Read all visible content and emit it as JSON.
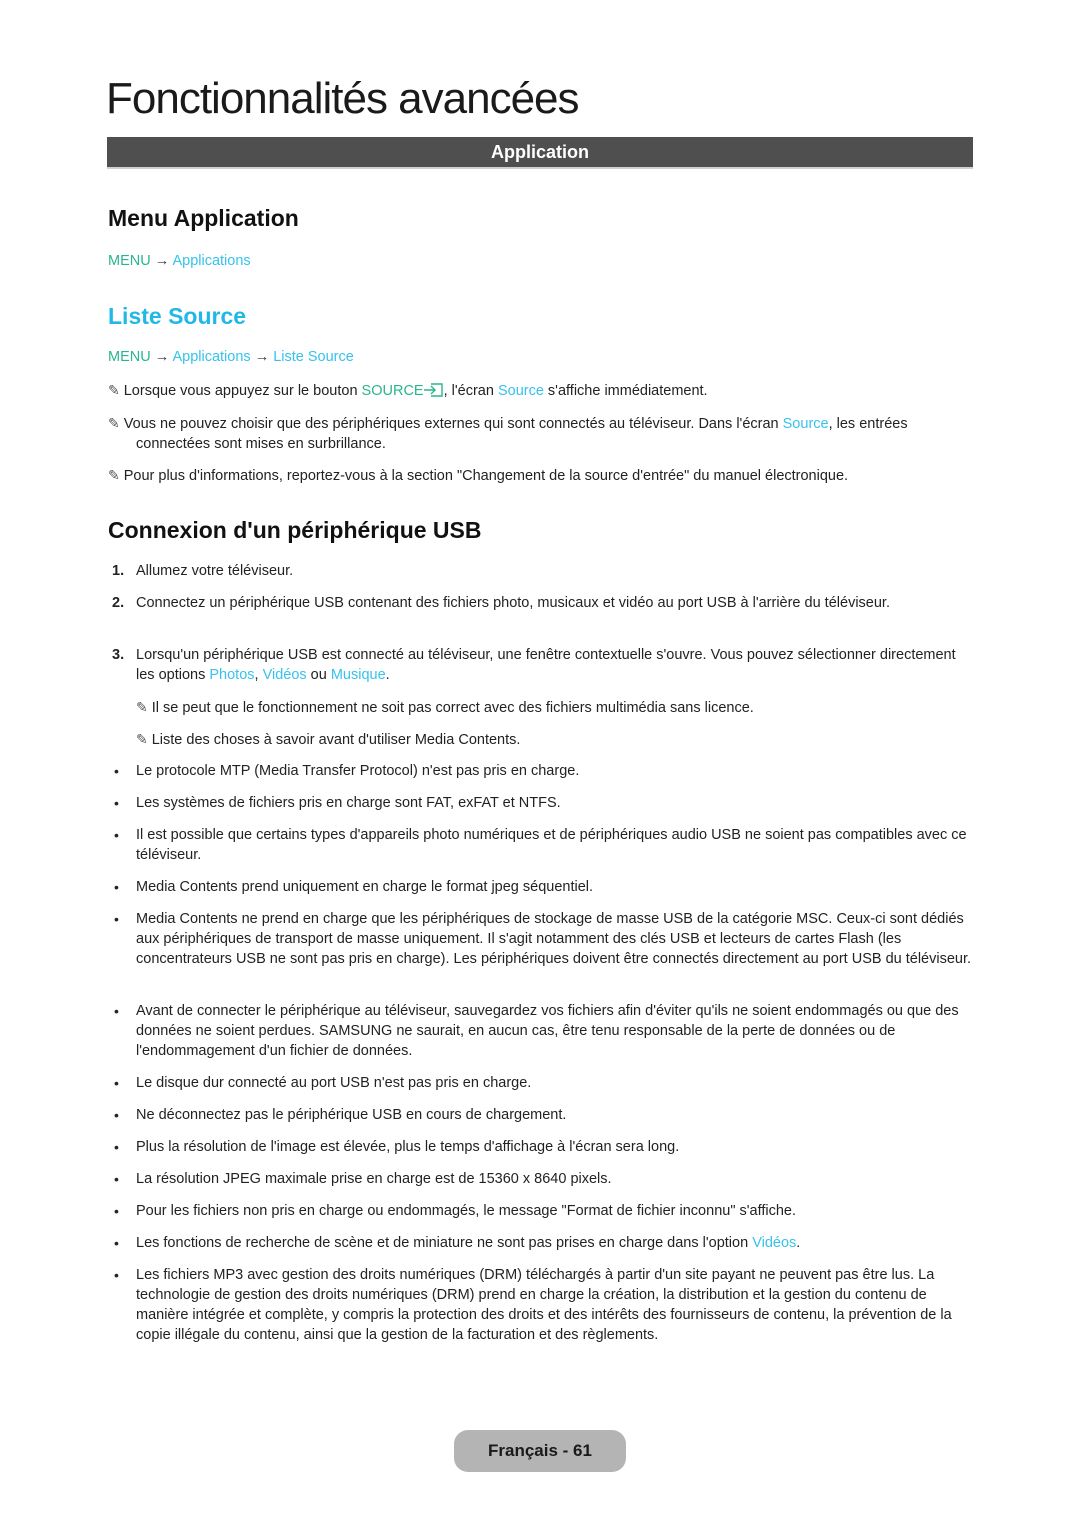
{
  "page": {
    "title": "Fonctionnalités avancées",
    "section_bar": "Application"
  },
  "menu_application": {
    "heading": "Menu Application",
    "breadcrumb": {
      "menu": "MENU",
      "arrow": "→",
      "items": [
        "Applications"
      ]
    }
  },
  "liste_source": {
    "heading": "Liste Source",
    "breadcrumb": {
      "menu": "MENU",
      "arrow": "→",
      "items": [
        "Applications",
        "Liste Source"
      ]
    },
    "notes": [
      {
        "before": "Lorsque vous appuyez sur le bouton ",
        "button": "SOURCE",
        "middle": ", l'écran ",
        "link": "Source",
        "after": " s'affiche immédiatement."
      },
      {
        "before": "Vous ne pouvez choisir que des périphériques externes qui sont connectés au téléviseur. Dans l'écran ",
        "link": "Source",
        "after": ", les entrées connectées sont mises en surbrillance."
      },
      {
        "text": "Pour plus d'informations, reportez-vous à la section \"Changement de la source d'entrée\" du manuel électronique."
      }
    ]
  },
  "usb": {
    "heading": "Connexion d'un périphérique USB",
    "steps": [
      {
        "num": "1.",
        "text": "Allumez votre téléviseur."
      },
      {
        "num": "2.",
        "text": "Connectez un périphérique USB contenant des fichiers photo, musicaux et vidéo au port USB à l'arrière du téléviseur."
      },
      {
        "num": "3.",
        "before": "Lorsqu'un périphérique USB est connecté au téléviseur, une fenêtre contextuelle s'ouvre. Vous pouvez sélectionner directement les options ",
        "opt1": "Photos",
        "sep1": ", ",
        "opt2": "Vidéos",
        "sep2": " ou ",
        "opt3": "Musique",
        "after": "."
      }
    ],
    "notes": [
      "Il se peut que le fonctionnement ne soit pas correct avec des fichiers multimédia sans licence.",
      "Liste des choses à savoir avant d'utiliser Media Contents."
    ],
    "bullets": [
      "Le protocole MTP (Media Transfer Protocol) n'est pas pris en charge.",
      "Les systèmes de fichiers pris en charge sont FAT, exFAT et NTFS.",
      "Il est possible que certains types d'appareils photo numériques et de périphériques audio USB ne soient pas compatibles avec ce téléviseur.",
      "Media Contents prend uniquement en charge le format jpeg séquentiel.",
      "Media Contents ne prend en charge que les périphériques de stockage de masse USB de la catégorie MSC. Ceux-ci sont dédiés aux périphériques de transport de masse uniquement. Il s'agit notamment des clés USB et lecteurs de cartes Flash (les concentrateurs USB ne sont pas pris en charge). Les périphériques doivent être connectés directement au port USB du téléviseur.",
      "Avant de connecter le périphérique au téléviseur, sauvegardez vos fichiers afin d'éviter qu'ils ne soient endommagés ou que des données ne soient perdues. SAMSUNG ne saurait, en aucun cas, être tenu responsable de la perte de données ou de l'endommagement d'un fichier de données.",
      "Le disque dur connecté au port USB n'est pas pris en charge.",
      "Ne déconnectez pas le périphérique USB en cours de chargement.",
      "Plus la résolution de l'image est élevée, plus le temps d'affichage à l'écran sera long.",
      "La résolution JPEG maximale prise en charge est de 15360 x 8640 pixels.",
      "Pour les fichiers non pris en charge ou endommagés, le message \"Format de fichier inconnu\" s'affiche.",
      {
        "before": "Les fonctions de recherche de scène et de miniature ne sont pas prises en charge dans l'option ",
        "link": "Vidéos",
        "after": "."
      },
      "Les fichiers MP3 avec gestion des droits numériques (DRM) téléchargés à partir d'un site payant ne peuvent pas être lus. La technologie de gestion des droits numériques (DRM) prend en charge la création, la distribution et la gestion du contenu de manière intégrée et complète, y compris la protection des droits et des intérêts des fournisseurs de contenu, la prévention de la copie illégale du contenu, ainsi que la gestion de la facturation et des règlements."
    ]
  },
  "footer": {
    "label": "Français - 61"
  },
  "icons": {
    "note": "✎",
    "bullet": "•"
  },
  "colors": {
    "accent_blue": "#21b8e8",
    "menu_green": "#2ab58e",
    "section_bar": "#4f4f4f",
    "footer_pill": "#b4b4b4"
  }
}
